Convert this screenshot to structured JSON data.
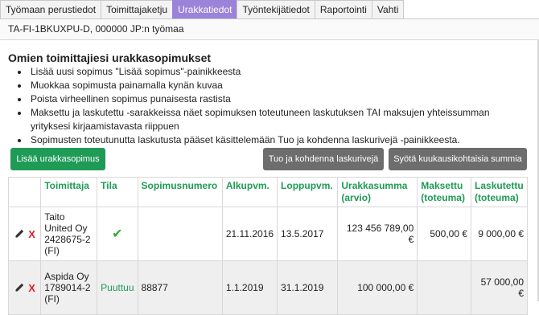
{
  "tabs": [
    {
      "label": "Työmaan perustiedot",
      "active": false
    },
    {
      "label": "Toimittajaketju",
      "active": false
    },
    {
      "label": "Urakkatiedot",
      "active": true
    },
    {
      "label": "Työntekijätiedot",
      "active": false
    },
    {
      "label": "Raportointi",
      "active": false
    },
    {
      "label": "Vahti",
      "active": false
    }
  ],
  "subheader": "TA-FI-1BKUXPU-D, 000000 JP:n työmaa",
  "page_title": "Omien toimittajiesi urakkasopimukset",
  "instructions": [
    "Lisää uusi sopimus \"Lisää sopimus\"-painikkeesta",
    "Muokkaa sopimusta painamalla kynän kuvaa",
    "Poista virheellinen sopimus punaisesta rastista",
    "Maksettu ja laskutettu -sarakkeissa näet sopimuksen toteutuneen laskutuksen TAI maksujen yhteissumman yrityksesi kirjaamistavasta riippuen",
    "Sopimusten toteutunutta laskutusta pääset käsittelemään Tuo ja kohdenna laskurivejä -painikkeesta."
  ],
  "buttons": {
    "add_contract": "Lisää urakkasopimus",
    "import_rows": "Tuo ja kohdenna laskurivejä",
    "monthly_sums": "Syötä kuukausikohtaisia summia"
  },
  "table": {
    "headers": {
      "supplier": "Toimittaja",
      "status": "Tila",
      "contract_number": "Sopimusnumero",
      "start": "Alkupvm.",
      "end": "Loppupvm.",
      "contract_sum": "Urakkasumma (arvio)",
      "paid": "Maksettu (toteuma)",
      "invoiced": "Laskutettu (toteuma)"
    },
    "rows": [
      {
        "supplier": "Taito United Oy 2428675-2 (FI)",
        "status": "",
        "status_icon": "check-icon",
        "contract_number": "",
        "start": "21.11.2016",
        "end": "13.5.2017",
        "contract_sum": "123 456 789,00 €",
        "paid": "500,00 €",
        "invoiced": "9 000,00 €"
      },
      {
        "supplier": "Aspida Oy 1789014-2 (FI)",
        "status": "Puuttuu",
        "status_icon": "",
        "contract_number": "88877",
        "start": "1.1.2019",
        "end": "31.1.2019",
        "contract_sum": "100 000,00 €",
        "paid": "",
        "invoiced": "57 000,00 €"
      }
    ]
  },
  "colors": {
    "accent_green": "#1f9b57",
    "active_tab": "#9b83d9",
    "delete_red": "#e02020",
    "gray_button": "#6d6d6d"
  }
}
